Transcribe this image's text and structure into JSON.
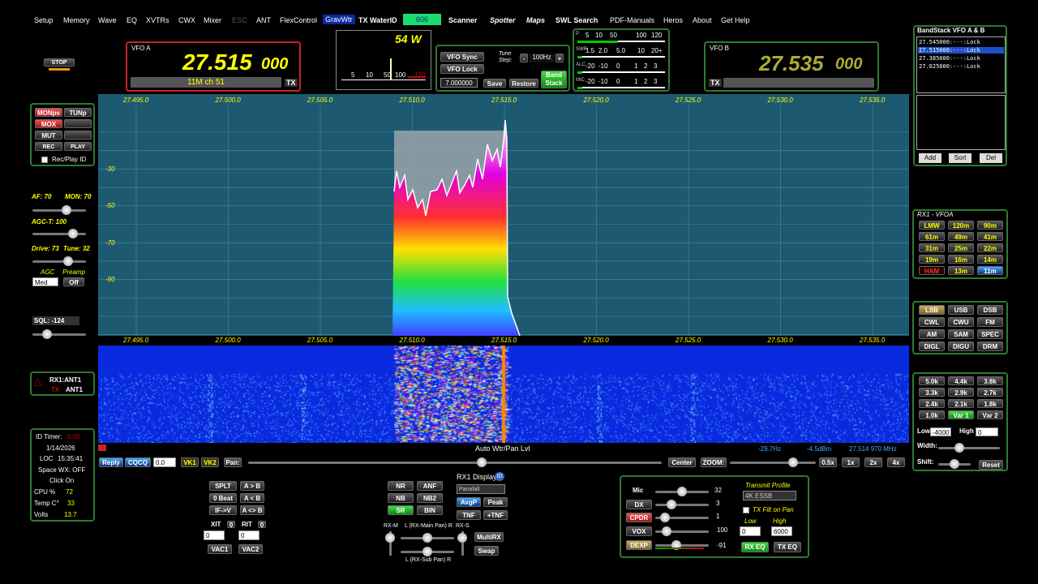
{
  "menu": {
    "items": [
      "Setup",
      "Memory",
      "Wave",
      "EQ",
      "XVTRs",
      "CWX",
      "Mixer",
      "ESC",
      "ANT",
      "FlexControl",
      "GravWtr",
      "TX WaterID",
      "606",
      "Scanner",
      "Spotter",
      "Maps",
      "SWL Search",
      "PDF-Manuals",
      "Heros",
      "About",
      "Get Help"
    ]
  },
  "stop": "STOP",
  "vfoa": {
    "label": "VFO A",
    "mhz": "27.515",
    "khz": "000",
    "band": "11M ch 51",
    "tx": "TX"
  },
  "vfob": {
    "label": "VFO B",
    "mhz": "27.535",
    "khz": "000",
    "tx": "TX"
  },
  "power": {
    "value": "54 W",
    "scale": [
      "5",
      "10",
      "50",
      "100",
      "120"
    ]
  },
  "vfoctl": {
    "sync": "VFO Sync",
    "lock": "VFO Lock",
    "tunestep_label": "Tune Step:",
    "tunestep": "100Hz",
    "freq": "7.000000",
    "save": "Save",
    "restore": "Restore",
    "bandstack": "Band Stack"
  },
  "meter": {
    "pscale": [
      "P",
      "5",
      "10",
      "50",
      "100",
      "120"
    ],
    "swr": [
      "SWR",
      "1.5",
      "2.0",
      "5.0",
      "10",
      "20+"
    ],
    "alc": [
      "ALC",
      "-20",
      "-10",
      "0",
      "1",
      "2",
      "3"
    ],
    "mic": [
      "MIC",
      "-20",
      "-10",
      "0",
      "1",
      "2",
      "3"
    ]
  },
  "bandstack": {
    "title": "BandStack VFO A & B",
    "entries": [
      "27.545000:---:Lock",
      "27.515000:---:Lock",
      "27.385000:---:Lock",
      "27.025000:---:Lock"
    ],
    "selected": 1,
    "add": "Add",
    "sort": "Sort",
    "del": "Del"
  },
  "left": {
    "mon": "MONps",
    "tun": "TUNp",
    "mox": "MOX",
    "mut": "MUT",
    "rec": "REC",
    "play": "PLAY",
    "recplayid": "Rec/Play ID",
    "af": "AF: 70",
    "monv": "MON: 70",
    "agct": "AGC-T: 100",
    "drive": "Drive: 73",
    "tune": "Tune: 32",
    "agc": "AGC",
    "preamp": "Preamp",
    "agcval": "Med",
    "preampval": "Off",
    "sql": "SQL: -124",
    "rx1ant": "RX1:ANT1",
    "txant": "ANT1",
    "tx": "TX"
  },
  "idbox": {
    "idtimer": "ID Timer:",
    "idval": "0:00",
    "date": "1/14/2026",
    "loc": "LOC",
    "time": "15:35:41",
    "spacewx": "Space WX: OFF",
    "click": "Click On",
    "cpu_l": "CPU %",
    "cpu": "72",
    "temp_l": "Temp C°",
    "temp": "33",
    "volts_l": "Volts",
    "volts": "13.7"
  },
  "pano": {
    "freqs": [
      "27.495.0",
      "27.500.0",
      "27.505.0",
      "27.510.0",
      "27.515.0",
      "27.520.0",
      "27.525.0",
      "27.530.0",
      "27.535.0"
    ],
    "db": [
      "-30",
      "-50",
      "-70",
      "-90"
    ]
  },
  "status": {
    "autowtr": "Auto Wtr/Pan Lvl",
    "hz": "-29.7Hz",
    "dbm": "-4.5dBm",
    "mhz": "27.514 970 MHz"
  },
  "bottombar": {
    "reply": "Reply",
    "cqcq": "CQCQ",
    "val": "0.0",
    "vk1": "VK1",
    "vk2": "VK2",
    "pan": "Pan:",
    "center": "Center",
    "zoom": "ZOOM:",
    "z": [
      "0.5x",
      "1x",
      "2x",
      "4x"
    ]
  },
  "splt": [
    "SPLT",
    "A > B",
    "0 Beat",
    "A < B",
    "IF->V",
    "A <> B"
  ],
  "xit": "XIT",
  "rit": "RIT",
  "xitv": "0",
  "ritv": "0",
  "vac1": "VAC1",
  "vac2": "VAC2",
  "dsp": {
    "nr": "NR",
    "anf": "ANF",
    "nb": "NB",
    "nb2": "NB2",
    "sr": "SR",
    "bin": "BIN",
    "rxm": "RX-M",
    "lmain": "L (RX-Main Pan) R",
    "rxs": "RX-S",
    "lsub": "L (RX-Sub Pan) R"
  },
  "rx1disp": {
    "title": "RX1 Display",
    "mode": "Panafall",
    "avgp": "AvgP",
    "peak": "Peak",
    "tnf": "TNF",
    "ptnf": "+TNF",
    "multirx": "MultiRX",
    "swap": "Swap"
  },
  "tx": {
    "mic": "Mic",
    "micv": "32",
    "dx": "DX",
    "dxv": "3",
    "cpdr": "CPDR",
    "cpdrv": "1",
    "vox": "VOX",
    "voxv": "100",
    "dexp": "DEXP",
    "dexpv": "-91",
    "profile_l": "Transmit Profile",
    "profile": "4K ESSB",
    "txfilt": "TX Filt on Pan",
    "low_l": "Low",
    "high_l": "High",
    "low": "0",
    "high": "6000",
    "rxeq": "RX EQ",
    "txeq": "TX EQ"
  },
  "bands": {
    "title": "RX1 - VFOA",
    "items": [
      "LMW",
      "120m",
      "90m",
      "61m",
      "49m",
      "41m",
      "31m",
      "25m",
      "22m",
      "19m",
      "16m",
      "14m",
      "HAM",
      "13m",
      "11m"
    ]
  },
  "modes": [
    "LSB",
    "USB",
    "DSB",
    "CWL",
    "CWU",
    "FM",
    "AM",
    "SAM",
    "SPEC",
    "DIGL",
    "DIGU",
    "DRM"
  ],
  "filters": {
    "items": [
      "5.0k",
      "4.4k",
      "3.8k",
      "3.3k",
      "2.9k",
      "2.7k",
      "2.4k",
      "2.1k",
      "1.8k",
      "1.0k",
      "Var 1",
      "Var 2"
    ],
    "low_l": "Low",
    "low": "-4000",
    "high_l": "High",
    "high": "0",
    "width": "Width:",
    "shift": "Shift:",
    "reset": "Reset"
  },
  "colors": {
    "pano": "#1d5a72",
    "wf": "#0a2ae0",
    "freq": "#ffff00",
    "border": "#2f7a2f"
  }
}
